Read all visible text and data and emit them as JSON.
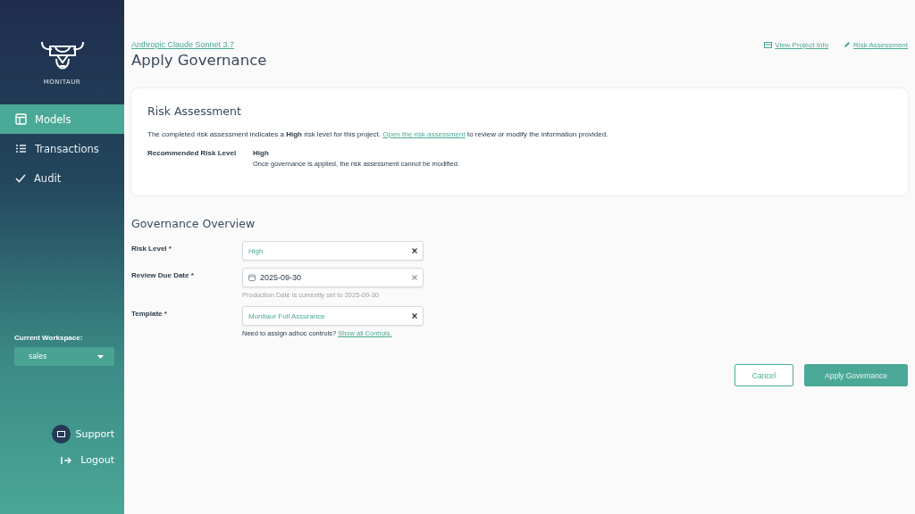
{
  "sidebar": {
    "logo_text": "MONITAUR",
    "nav": [
      {
        "label": "Models",
        "selected": true
      },
      {
        "label": "Transactions",
        "selected": false
      },
      {
        "label": "Audit",
        "selected": false
      }
    ],
    "workspace_label": "Current Workspace:",
    "workspace": "sales",
    "support": "Support",
    "logout": "Logout"
  },
  "header": {
    "breadcrumb": "Anthropic Claude Sonnet 3.7",
    "title": "Apply Governance",
    "links": [
      {
        "label": "View Project Info"
      },
      {
        "label": "Risk Assessment"
      }
    ]
  },
  "risk_card": {
    "title": "Risk Assessment",
    "text_before": "The completed risk assessment indicates a **High** risk level for this project.",
    "link": "Open the risk assessment",
    "text_after": "to review or modify the information provided.",
    "label": "Recommended Risk Level",
    "value": "High",
    "note": "Once governance is applied, the risk assessment cannot be modified."
  },
  "governance": {
    "title": "Governance Overview",
    "fields": [
      {
        "label": "Risk Level *",
        "kind": "select",
        "value": "High"
      },
      {
        "label": "Review Due Date *",
        "kind": "date",
        "value": "2025-09-30",
        "hint": "Production Date is currently set to 2025-09-30"
      },
      {
        "label": "Template *",
        "kind": "select",
        "value": "Monitaur Full Assurance",
        "hint": "Need to assign adhoc controls?",
        "hint_link": "Show all Controls."
      }
    ]
  },
  "buttons": [
    {
      "label": "Cancel",
      "kind": "secondary"
    },
    {
      "label": "Apply Governance",
      "kind": "primary"
    }
  ]
}
